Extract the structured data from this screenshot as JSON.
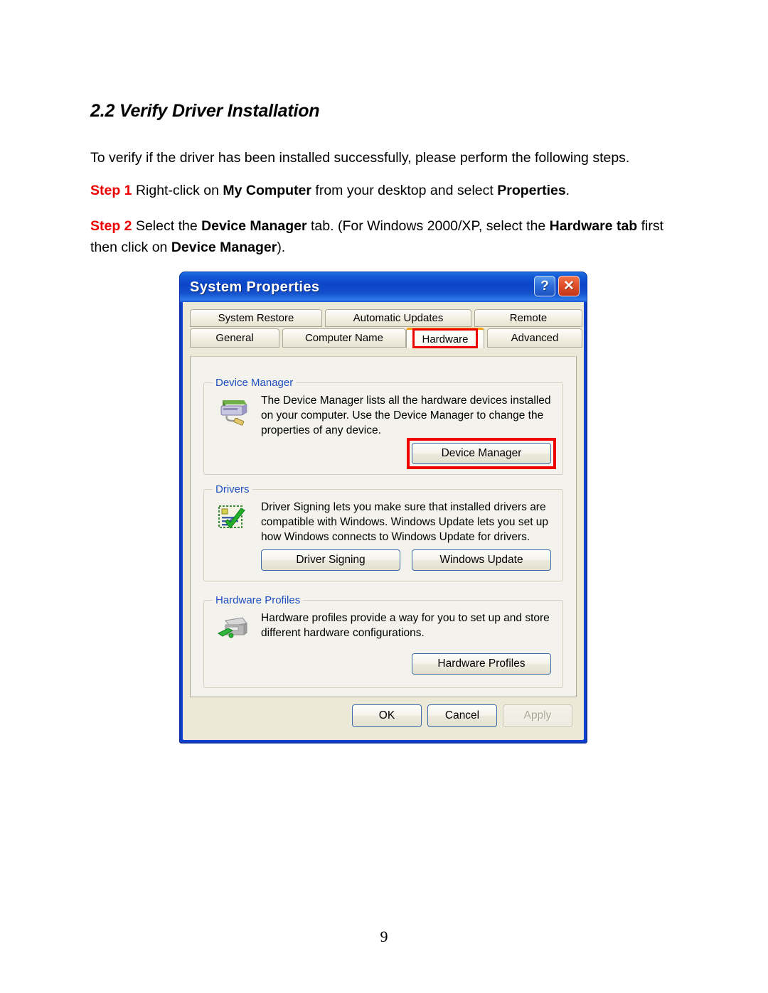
{
  "document": {
    "section_title": "2.2 Verify Driver Installation",
    "intro": "To verify if the driver has been installed successfully, please perform the following steps.",
    "step1": {
      "label": "Step 1",
      "text_a": " Right-click on ",
      "bold_a": "My Computer",
      "text_b": " from your desktop and select ",
      "bold_b": "Properties",
      "text_c": "."
    },
    "step2": {
      "label": "Step 2",
      "text_a": " Select the ",
      "bold_a": "Device Manager",
      "text_b": " tab. (For Windows 2000/XP, select the ",
      "bold_b": "Hardware tab",
      "text_c": " first then click on ",
      "bold_c": "Device Manager",
      "text_d": ")."
    },
    "page_number": "9"
  },
  "dialog": {
    "title": "System Properties",
    "titlebar_buttons": {
      "help": "?",
      "close": "✕"
    },
    "tabs_row1": [
      {
        "label": "System Restore",
        "selected": false
      },
      {
        "label": "Automatic Updates",
        "selected": false
      },
      {
        "label": "Remote",
        "selected": false
      }
    ],
    "tabs_row2": [
      {
        "label": "General",
        "selected": false
      },
      {
        "label": "Computer Name",
        "selected": false
      },
      {
        "label": "Hardware",
        "selected": true
      },
      {
        "label": "Advanced",
        "selected": false
      }
    ],
    "groups": {
      "device_manager": {
        "title": "Device Manager",
        "description": "The Device Manager lists all the hardware devices installed on your computer. Use the Device Manager to change the properties of any device.",
        "button": "Device Manager"
      },
      "drivers": {
        "title": "Drivers",
        "description": "Driver Signing lets you make sure that installed drivers are compatible with Windows. Windows Update lets you set up how Windows connects to Windows Update for drivers.",
        "button_left": "Driver Signing",
        "button_right": "Windows Update"
      },
      "hardware_profiles": {
        "title": "Hardware Profiles",
        "description": "Hardware profiles provide a way for you to set up and store different hardware configurations.",
        "button": "Hardware Profiles"
      }
    },
    "footer": {
      "ok": "OK",
      "cancel": "Cancel",
      "apply": "Apply"
    },
    "colors": {
      "titlebar_blue": "#0c45c8",
      "dialog_background": "#ece9d8",
      "panel_background": "#f3f2ec",
      "group_label_blue": "#1f4fc0",
      "highlight_red": "#ee0000",
      "selected_tab_orange": "#f2a01a",
      "step_label_red": "#ee0000"
    }
  }
}
